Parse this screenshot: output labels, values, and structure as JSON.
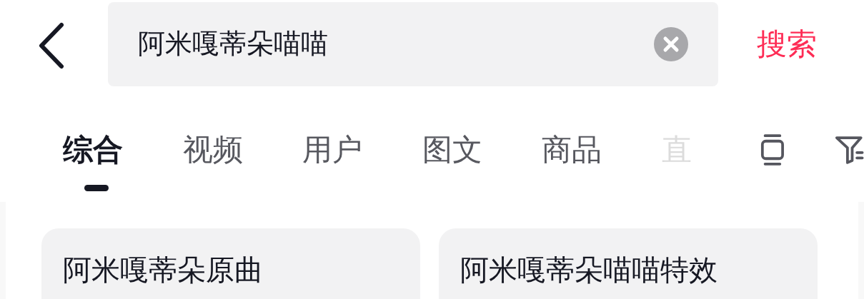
{
  "search": {
    "value": "阿米嘎蒂朵喵喵",
    "button": "搜索"
  },
  "tabs": [
    {
      "label": "综合",
      "selected": true
    },
    {
      "label": "视频",
      "selected": false
    },
    {
      "label": "用户",
      "selected": false
    },
    {
      "label": "图文",
      "selected": false
    },
    {
      "label": "商品",
      "selected": false
    },
    {
      "label": "直",
      "selected": false,
      "kind": "faded"
    }
  ],
  "suggestions": [
    {
      "label": "阿米嘎蒂朵原曲"
    },
    {
      "label": "阿米嘎蒂朵喵喵特效"
    }
  ]
}
